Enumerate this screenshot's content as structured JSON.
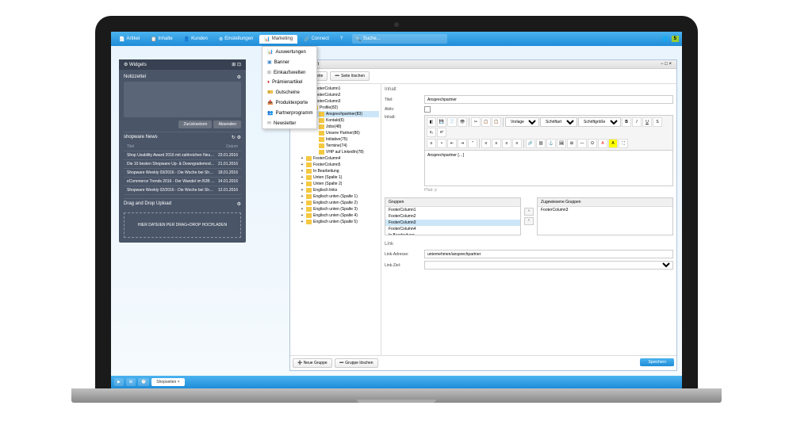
{
  "nav": {
    "artikel": "Artikel",
    "inhalte": "Inhalte",
    "kunden": "Kunden",
    "einstellungen": "Einstellungen",
    "marketing": "Marketing",
    "connect": "Connect",
    "hilfe": "?",
    "search_placeholder": "Suche..."
  },
  "dropdown": {
    "auswertungen": "Auswertungen",
    "banner": "Banner",
    "einkaufswelten": "Einkaufswelten",
    "praemienartikel": "Prämienartikel",
    "gutscheine": "Gutscheine",
    "produktexporte": "Produktexporte",
    "partnerprogramm": "Partnerprogramm",
    "newsletter": "Newsletter"
  },
  "widgets": {
    "title": "Widgets",
    "notepad_title": "Notizzettel",
    "btn_reset": "Zurücksetzen",
    "btn_send": "Absenden",
    "news_title": "shopware News",
    "col_title": "Titel",
    "col_date": "Datum",
    "news": [
      {
        "t": "Shop Usability Award 2016 mit zahlreichen Neue...",
        "d": "23.01.2016"
      },
      {
        "t": "Die 10 besten Shopware Up- & Downgrademod Shops",
        "d": "21.01.2016"
      },
      {
        "t": "Shopware Weekly 03/2016 - Die Woche bei Shopwa...",
        "d": "18.01.2016"
      },
      {
        "t": "eCommerce Trends 2016 - Der Wandel im B2B Segm...",
        "d": "14.01.2016"
      },
      {
        "t": "Shopware Weekly 02/2016 - Die Woche bei Shopwa...",
        "d": "12.01.2016"
      }
    ],
    "upload_title": "Drag and Drop Upload",
    "upload_text": "HIER DATEIEN PER DRAG+DROP HOCHLADEN"
  },
  "panel": {
    "title": "Shopseiten",
    "btn_new": "Neue Seite",
    "btn_delete": "Seite löschen",
    "tree": [
      {
        "l": "FooterColumn1",
        "i": 1,
        "e": "+"
      },
      {
        "l": "FooterColumn2",
        "i": 1,
        "e": "+"
      },
      {
        "l": "FooterColumn3",
        "i": 1,
        "e": "−"
      },
      {
        "l": "Profile(82)",
        "i": 2,
        "e": "−"
      },
      {
        "l": "Ansprechpartner(83)",
        "i": 3,
        "sel": true
      },
      {
        "l": "Kontakt(6)",
        "i": 3
      },
      {
        "l": "Jobs(48)",
        "i": 3
      },
      {
        "l": "Unsere Partner(86)",
        "i": 3
      },
      {
        "l": "Initiative(75)",
        "i": 3
      },
      {
        "l": "Termine(74)",
        "i": 3
      },
      {
        "l": "VHP auf LinkedIn(78)",
        "i": 3
      },
      {
        "l": "FooterColumn4",
        "i": 1,
        "e": "+"
      },
      {
        "l": "FooterColumn5",
        "i": 1,
        "e": "+"
      },
      {
        "l": "In Bearbeitung",
        "i": 1,
        "e": "+"
      },
      {
        "l": "Unten (Spalte 1)",
        "i": 1,
        "e": "+"
      },
      {
        "l": "Unten (Spalte 2)",
        "i": 1,
        "e": "+"
      },
      {
        "l": "Englisch links",
        "i": 1,
        "e": "+"
      },
      {
        "l": "Englisch unten (Spalte 1)",
        "i": 1,
        "e": "+"
      },
      {
        "l": "Englisch unten (Spalte 2)",
        "i": 1,
        "e": "+"
      },
      {
        "l": "Englisch unten (Spalte 3)",
        "i": 1,
        "e": "+"
      },
      {
        "l": "Englisch unten (Spalte 4)",
        "i": 1,
        "e": "+"
      },
      {
        "l": "Englisch unten (Spalte 5)",
        "i": 1,
        "e": "+"
      }
    ],
    "form": {
      "section_content": "Inhalt",
      "label_title": "Titel:",
      "title_value": "Ansprechpartner",
      "label_active": "Aktiv:",
      "label_content": "Inhalt:",
      "editor_content": "Ansprechpartner […]",
      "path_label": "Pfad: p",
      "ed_vorlage": "Vorlage",
      "ed_schriftart": "Schriftart",
      "ed_schriftgr": "Schriftgröße",
      "groups_label": "Gruppen",
      "assigned_label": "Zugewiesene Gruppen",
      "groups": [
        "FooterColumn1",
        "FooterColumn2",
        "FooterColumn3",
        "FooterColumn4",
        "In Bearbeitung"
      ],
      "assigned": [
        "FooterColumn3"
      ],
      "section_link": "Link",
      "label_link_addr": "Link-Adresse:",
      "link_value": "unternehmen/ansprechpartner",
      "label_link_target": "Link-Ziel:"
    },
    "footer": {
      "new_group": "Neue Gruppe",
      "delete_group": "Gruppe löschen",
      "save": "Speichern"
    }
  },
  "bottombar": {
    "tab": "Shopseiten"
  }
}
